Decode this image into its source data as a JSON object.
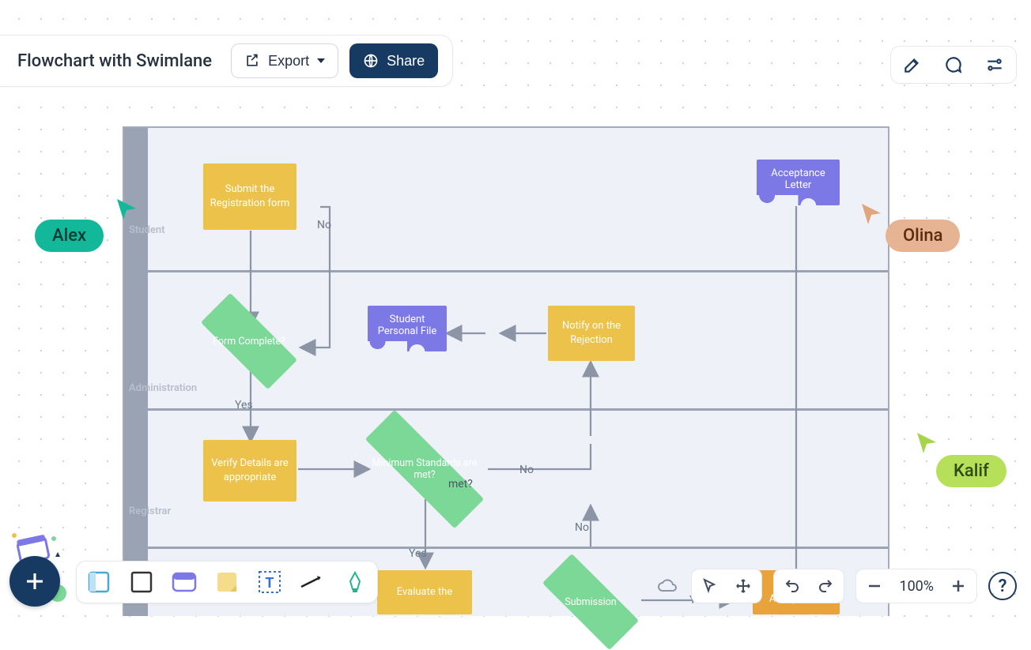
{
  "header": {
    "title": "Flowchart with Swimlane",
    "export_label": "Export",
    "share_label": "Share"
  },
  "toolbar_right": {
    "edit_icon": "edit-icon",
    "comment_icon": "comment-icon",
    "settings_icon": "sliders-icon"
  },
  "swimlanes": [
    {
      "name": "Student"
    },
    {
      "name": "Administration"
    },
    {
      "name": "Registrar"
    }
  ],
  "nodes": {
    "submit_form": "Submit the Registration form",
    "form_complete": "Form Complete?",
    "student_file": "Student Personal File",
    "notify_rejection": "Notify on the Rejection",
    "acceptance_letter": "Acceptance Letter",
    "verify_details": "Verify Details are appropriate",
    "min_standards": "Minimum Standards are met?",
    "met_overlay": "met?",
    "evaluate": "Evaluate the",
    "submission": "Submission",
    "write_acceptance": "Write Acceptance"
  },
  "edges": {
    "no1": "No",
    "yes1": "Yes",
    "no2": "No",
    "yes2": "Yes",
    "no3": "No",
    "yes3": "Yes"
  },
  "collaborators": {
    "alex": "Alex",
    "olina": "Olina",
    "kalif": "Kalif"
  },
  "bottom": {
    "zoom_label": "100%"
  }
}
